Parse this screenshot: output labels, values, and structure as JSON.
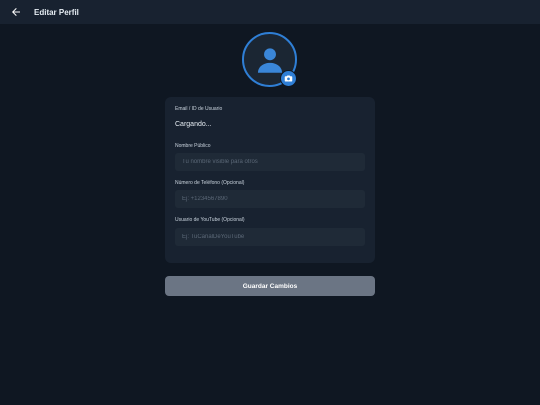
{
  "header": {
    "back_icon": "arrow-left-icon",
    "title": "Editar Perfil"
  },
  "avatar": {
    "placeholder_icon": "user-icon",
    "edit_icon": "camera-icon",
    "accent_color": "#2f7fd6"
  },
  "form": {
    "email": {
      "label": "Email / ID de Usuario",
      "value": "Cargando..."
    },
    "display_name": {
      "label": "Nombre Público",
      "placeholder": "Tu nombre visible para otros"
    },
    "phone": {
      "label": "Número de Teléfono (Opcional)",
      "placeholder": "Ej: +1234567890"
    },
    "youtube": {
      "label": "Usuario de YouTube (Opcional)",
      "placeholder": "Ej: TuCanalDeYouTube"
    }
  },
  "actions": {
    "save_label": "Guardar Cambios"
  }
}
